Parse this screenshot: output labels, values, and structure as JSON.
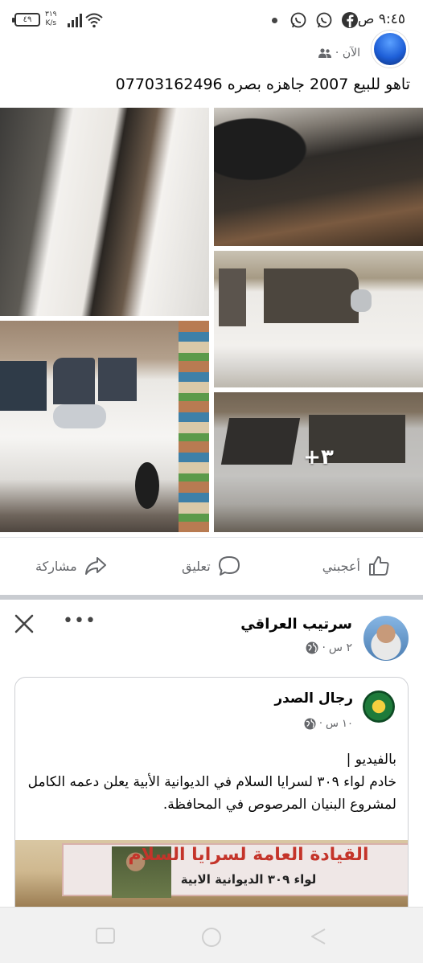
{
  "status_bar": {
    "time": "٩:٤٥ ص",
    "battery": "٤٩",
    "speed_top": "٣١٩",
    "speed_unit": "K/s"
  },
  "post1": {
    "time": "الآن",
    "text": "تاهو للبيع 2007 جاهزه بصره 07703162496",
    "more_photos": "٣+",
    "actions": {
      "like": "أعجبني",
      "comment": "تعليق",
      "share": "مشاركة"
    }
  },
  "post2": {
    "author": "سرتيب العراقي",
    "time": "٢ س",
    "shared": {
      "author": "رجال الصدر",
      "time": "١٠ س",
      "text": "بالفيديو |\nخادم لواء ٣٠٩ لسرايا السلام في الديوانية الأبية يعلن دعمه الكامل لمشروع البنيان المرصوص في المحافظة.",
      "banner_line1": "القيادة العامة لسرايا السلام",
      "banner_line2": "لواء ٣٠٩ الديوانية الابية"
    }
  },
  "colors": {
    "accent": "#1877f2",
    "secondary_text": "#65676b",
    "divider": "#c9ccd1"
  }
}
